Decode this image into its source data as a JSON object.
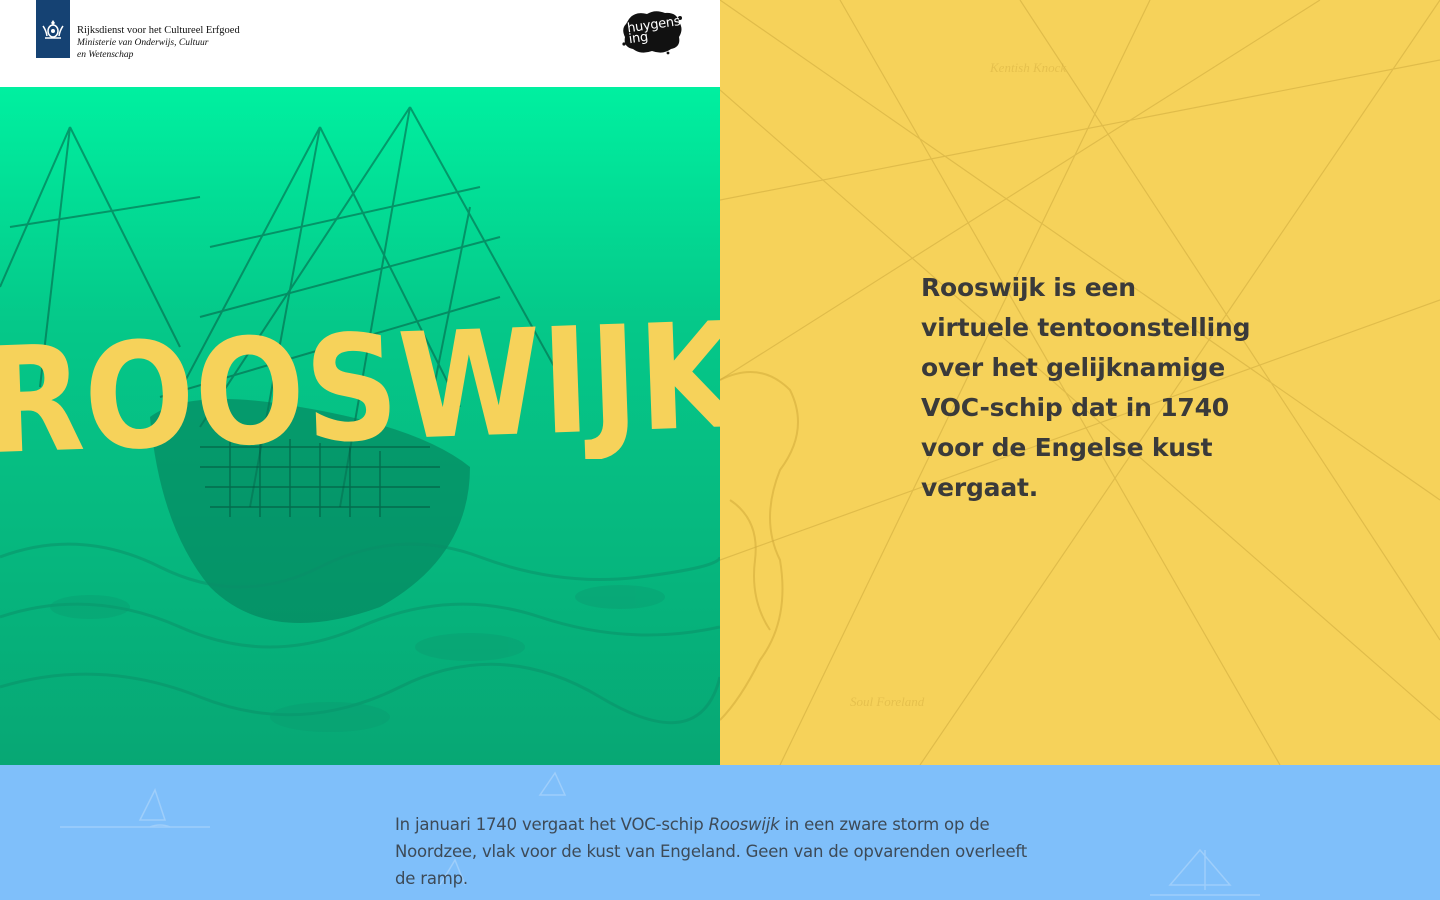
{
  "header": {
    "rijks_logo": {
      "line1": "Rijksdienst voor het Cultureel Erfgoed",
      "line2": "Ministerie van Onderwijs, Cultuur en Wetenschap",
      "icon": "rijkswapen-icon"
    },
    "huygens_logo": {
      "line1": "huygens",
      "line2": "ing"
    }
  },
  "hero": {
    "title": "ROOSWIJK",
    "title_color": "#f6d25a",
    "background_top": "#00f0a0",
    "background_bottom": "#07a774"
  },
  "intro": {
    "text": "Rooswijk is een virtuele tentoonstelling over het gelijknamige VOC-schip dat in 1740 voor de Engelse kust vergaat.",
    "background": "#f6d25a"
  },
  "story": {
    "text_before": "In januari 1740 vergaat het VOC-schip ",
    "text_em": "Rooswijk",
    "text_after": " in een zware storm op de Noordzee, vlak voor de kust van Engeland. Geen van de opvarenden overleeft de ramp.",
    "background": "#7fbffa"
  }
}
